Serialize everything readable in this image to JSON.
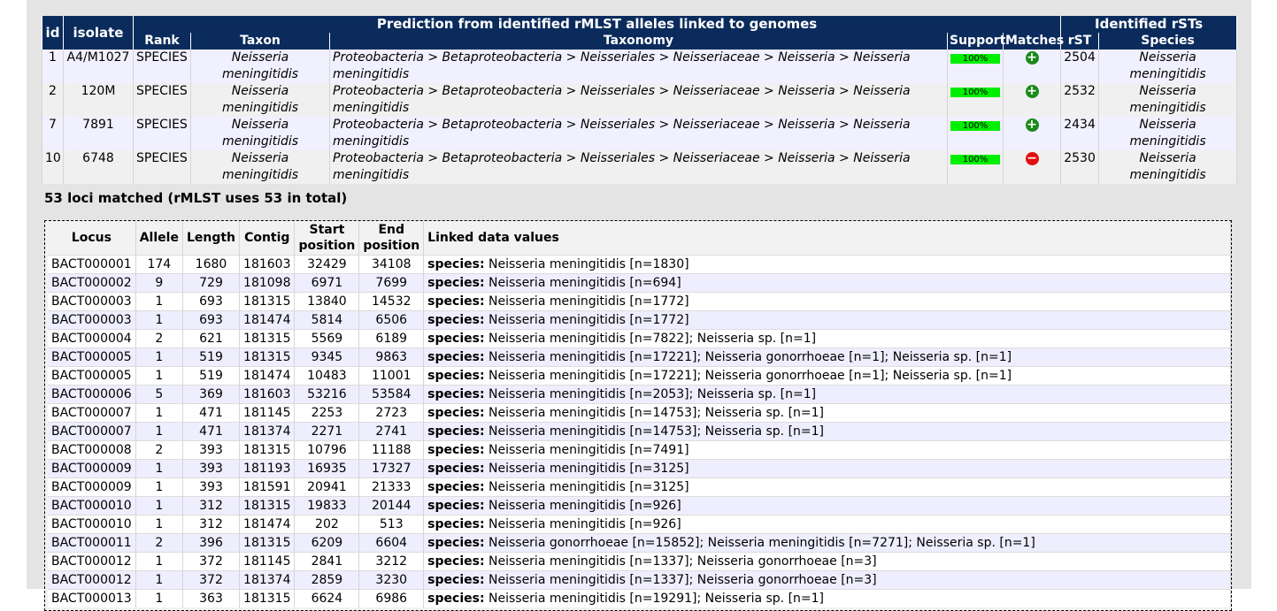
{
  "prediction": {
    "header_group": "Prediction from identified rMLST alleles linked to genomes",
    "rst_group": "Identified rSTs",
    "col_id": "id",
    "col_isolate": "isolate",
    "col_rank": "Rank",
    "col_taxon": "Taxon",
    "col_taxonomy": "Taxonomy",
    "col_support": "Support",
    "col_matches": "Matches",
    "col_rst": "rST",
    "col_species": "Species",
    "rows": [
      {
        "id": "1",
        "isolate": "A4/M1027",
        "rank": "SPECIES",
        "taxon": "Neisseria meningitidis",
        "taxonomy": "Proteobacteria > Betaproteobacteria > Neisseriales > Neisseriaceae > Neisseria > Neisseria meningitidis",
        "support": "100%",
        "match": "plus",
        "rst": "2504",
        "species": "Neisseria meningitidis"
      },
      {
        "id": "2",
        "isolate": "120M",
        "rank": "SPECIES",
        "taxon": "Neisseria meningitidis",
        "taxonomy": "Proteobacteria > Betaproteobacteria > Neisseriales > Neisseriaceae > Neisseria > Neisseria meningitidis",
        "support": "100%",
        "match": "plus",
        "rst": "2532",
        "species": "Neisseria meningitidis"
      },
      {
        "id": "7",
        "isolate": "7891",
        "rank": "SPECIES",
        "taxon": "Neisseria meningitidis",
        "taxonomy": "Proteobacteria > Betaproteobacteria > Neisseriales > Neisseriaceae > Neisseria > Neisseria meningitidis",
        "support": "100%",
        "match": "plus",
        "rst": "2434",
        "species": "Neisseria meningitidis"
      },
      {
        "id": "10",
        "isolate": "6748",
        "rank": "SPECIES",
        "taxon": "Neisseria meningitidis",
        "taxonomy": "Proteobacteria > Betaproteobacteria > Neisseriales > Neisseriaceae > Neisseria > Neisseria meningitidis",
        "support": "100%",
        "match": "minus",
        "rst": "2530",
        "species": "Neisseria meningitidis"
      }
    ]
  },
  "loci_summary": "53 loci matched (rMLST uses 53 in total)",
  "loci": {
    "headers": {
      "locus": "Locus",
      "allele": "Allele",
      "length": "Length",
      "contig": "Contig",
      "start": "Start position",
      "end": "End position",
      "linked": "Linked data values"
    },
    "species_label": "species:",
    "rows": [
      {
        "locus": "BACT000001",
        "allele": "174",
        "length": "1680",
        "contig": "181603",
        "start": "32429",
        "end": "34108",
        "value": "Neisseria meningitidis [n=1830]"
      },
      {
        "locus": "BACT000002",
        "allele": "9",
        "length": "729",
        "contig": "181098",
        "start": "6971",
        "end": "7699",
        "value": "Neisseria meningitidis [n=694]"
      },
      {
        "locus": "BACT000003",
        "allele": "1",
        "length": "693",
        "contig": "181315",
        "start": "13840",
        "end": "14532",
        "value": "Neisseria meningitidis [n=1772]"
      },
      {
        "locus": "BACT000003",
        "allele": "1",
        "length": "693",
        "contig": "181474",
        "start": "5814",
        "end": "6506",
        "value": "Neisseria meningitidis [n=1772]"
      },
      {
        "locus": "BACT000004",
        "allele": "2",
        "length": "621",
        "contig": "181315",
        "start": "5569",
        "end": "6189",
        "value": "Neisseria meningitidis [n=7822]; Neisseria sp. [n=1]"
      },
      {
        "locus": "BACT000005",
        "allele": "1",
        "length": "519",
        "contig": "181315",
        "start": "9345",
        "end": "9863",
        "value": "Neisseria meningitidis [n=17221]; Neisseria gonorrhoeae [n=1]; Neisseria sp. [n=1]"
      },
      {
        "locus": "BACT000005",
        "allele": "1",
        "length": "519",
        "contig": "181474",
        "start": "10483",
        "end": "11001",
        "value": "Neisseria meningitidis [n=17221]; Neisseria gonorrhoeae [n=1]; Neisseria sp. [n=1]"
      },
      {
        "locus": "BACT000006",
        "allele": "5",
        "length": "369",
        "contig": "181603",
        "start": "53216",
        "end": "53584",
        "value": "Neisseria meningitidis [n=2053]; Neisseria sp. [n=1]"
      },
      {
        "locus": "BACT000007",
        "allele": "1",
        "length": "471",
        "contig": "181145",
        "start": "2253",
        "end": "2723",
        "value": "Neisseria meningitidis [n=14753]; Neisseria sp. [n=1]"
      },
      {
        "locus": "BACT000007",
        "allele": "1",
        "length": "471",
        "contig": "181374",
        "start": "2271",
        "end": "2741",
        "value": "Neisseria meningitidis [n=14753]; Neisseria sp. [n=1]"
      },
      {
        "locus": "BACT000008",
        "allele": "2",
        "length": "393",
        "contig": "181315",
        "start": "10796",
        "end": "11188",
        "value": "Neisseria meningitidis [n=7491]"
      },
      {
        "locus": "BACT000009",
        "allele": "1",
        "length": "393",
        "contig": "181193",
        "start": "16935",
        "end": "17327",
        "value": "Neisseria meningitidis [n=3125]"
      },
      {
        "locus": "BACT000009",
        "allele": "1",
        "length": "393",
        "contig": "181591",
        "start": "20941",
        "end": "21333",
        "value": "Neisseria meningitidis [n=3125]"
      },
      {
        "locus": "BACT000010",
        "allele": "1",
        "length": "312",
        "contig": "181315",
        "start": "19833",
        "end": "20144",
        "value": "Neisseria meningitidis [n=926]"
      },
      {
        "locus": "BACT000010",
        "allele": "1",
        "length": "312",
        "contig": "181474",
        "start": "202",
        "end": "513",
        "value": "Neisseria meningitidis [n=926]"
      },
      {
        "locus": "BACT000011",
        "allele": "2",
        "length": "396",
        "contig": "181315",
        "start": "6209",
        "end": "6604",
        "value": "Neisseria gonorrhoeae [n=15852]; Neisseria meningitidis [n=7271]; Neisseria sp. [n=1]"
      },
      {
        "locus": "BACT000012",
        "allele": "1",
        "length": "372",
        "contig": "181145",
        "start": "2841",
        "end": "3212",
        "value": "Neisseria meningitidis [n=1337]; Neisseria gonorrhoeae [n=3]"
      },
      {
        "locus": "BACT000012",
        "allele": "1",
        "length": "372",
        "contig": "181374",
        "start": "2859",
        "end": "3230",
        "value": "Neisseria meningitidis [n=1337]; Neisseria gonorrhoeae [n=3]"
      },
      {
        "locus": "BACT000013",
        "allele": "1",
        "length": "363",
        "contig": "181315",
        "start": "6624",
        "end": "6986",
        "value": "Neisseria meningitidis [n=19291]; Neisseria sp. [n=1]"
      }
    ]
  },
  "colors": {
    "header_bg": "#0a2b5c",
    "support_bar": "#00ee00",
    "match_ok": "#1a8a1a",
    "match_bad": "#e01010"
  }
}
